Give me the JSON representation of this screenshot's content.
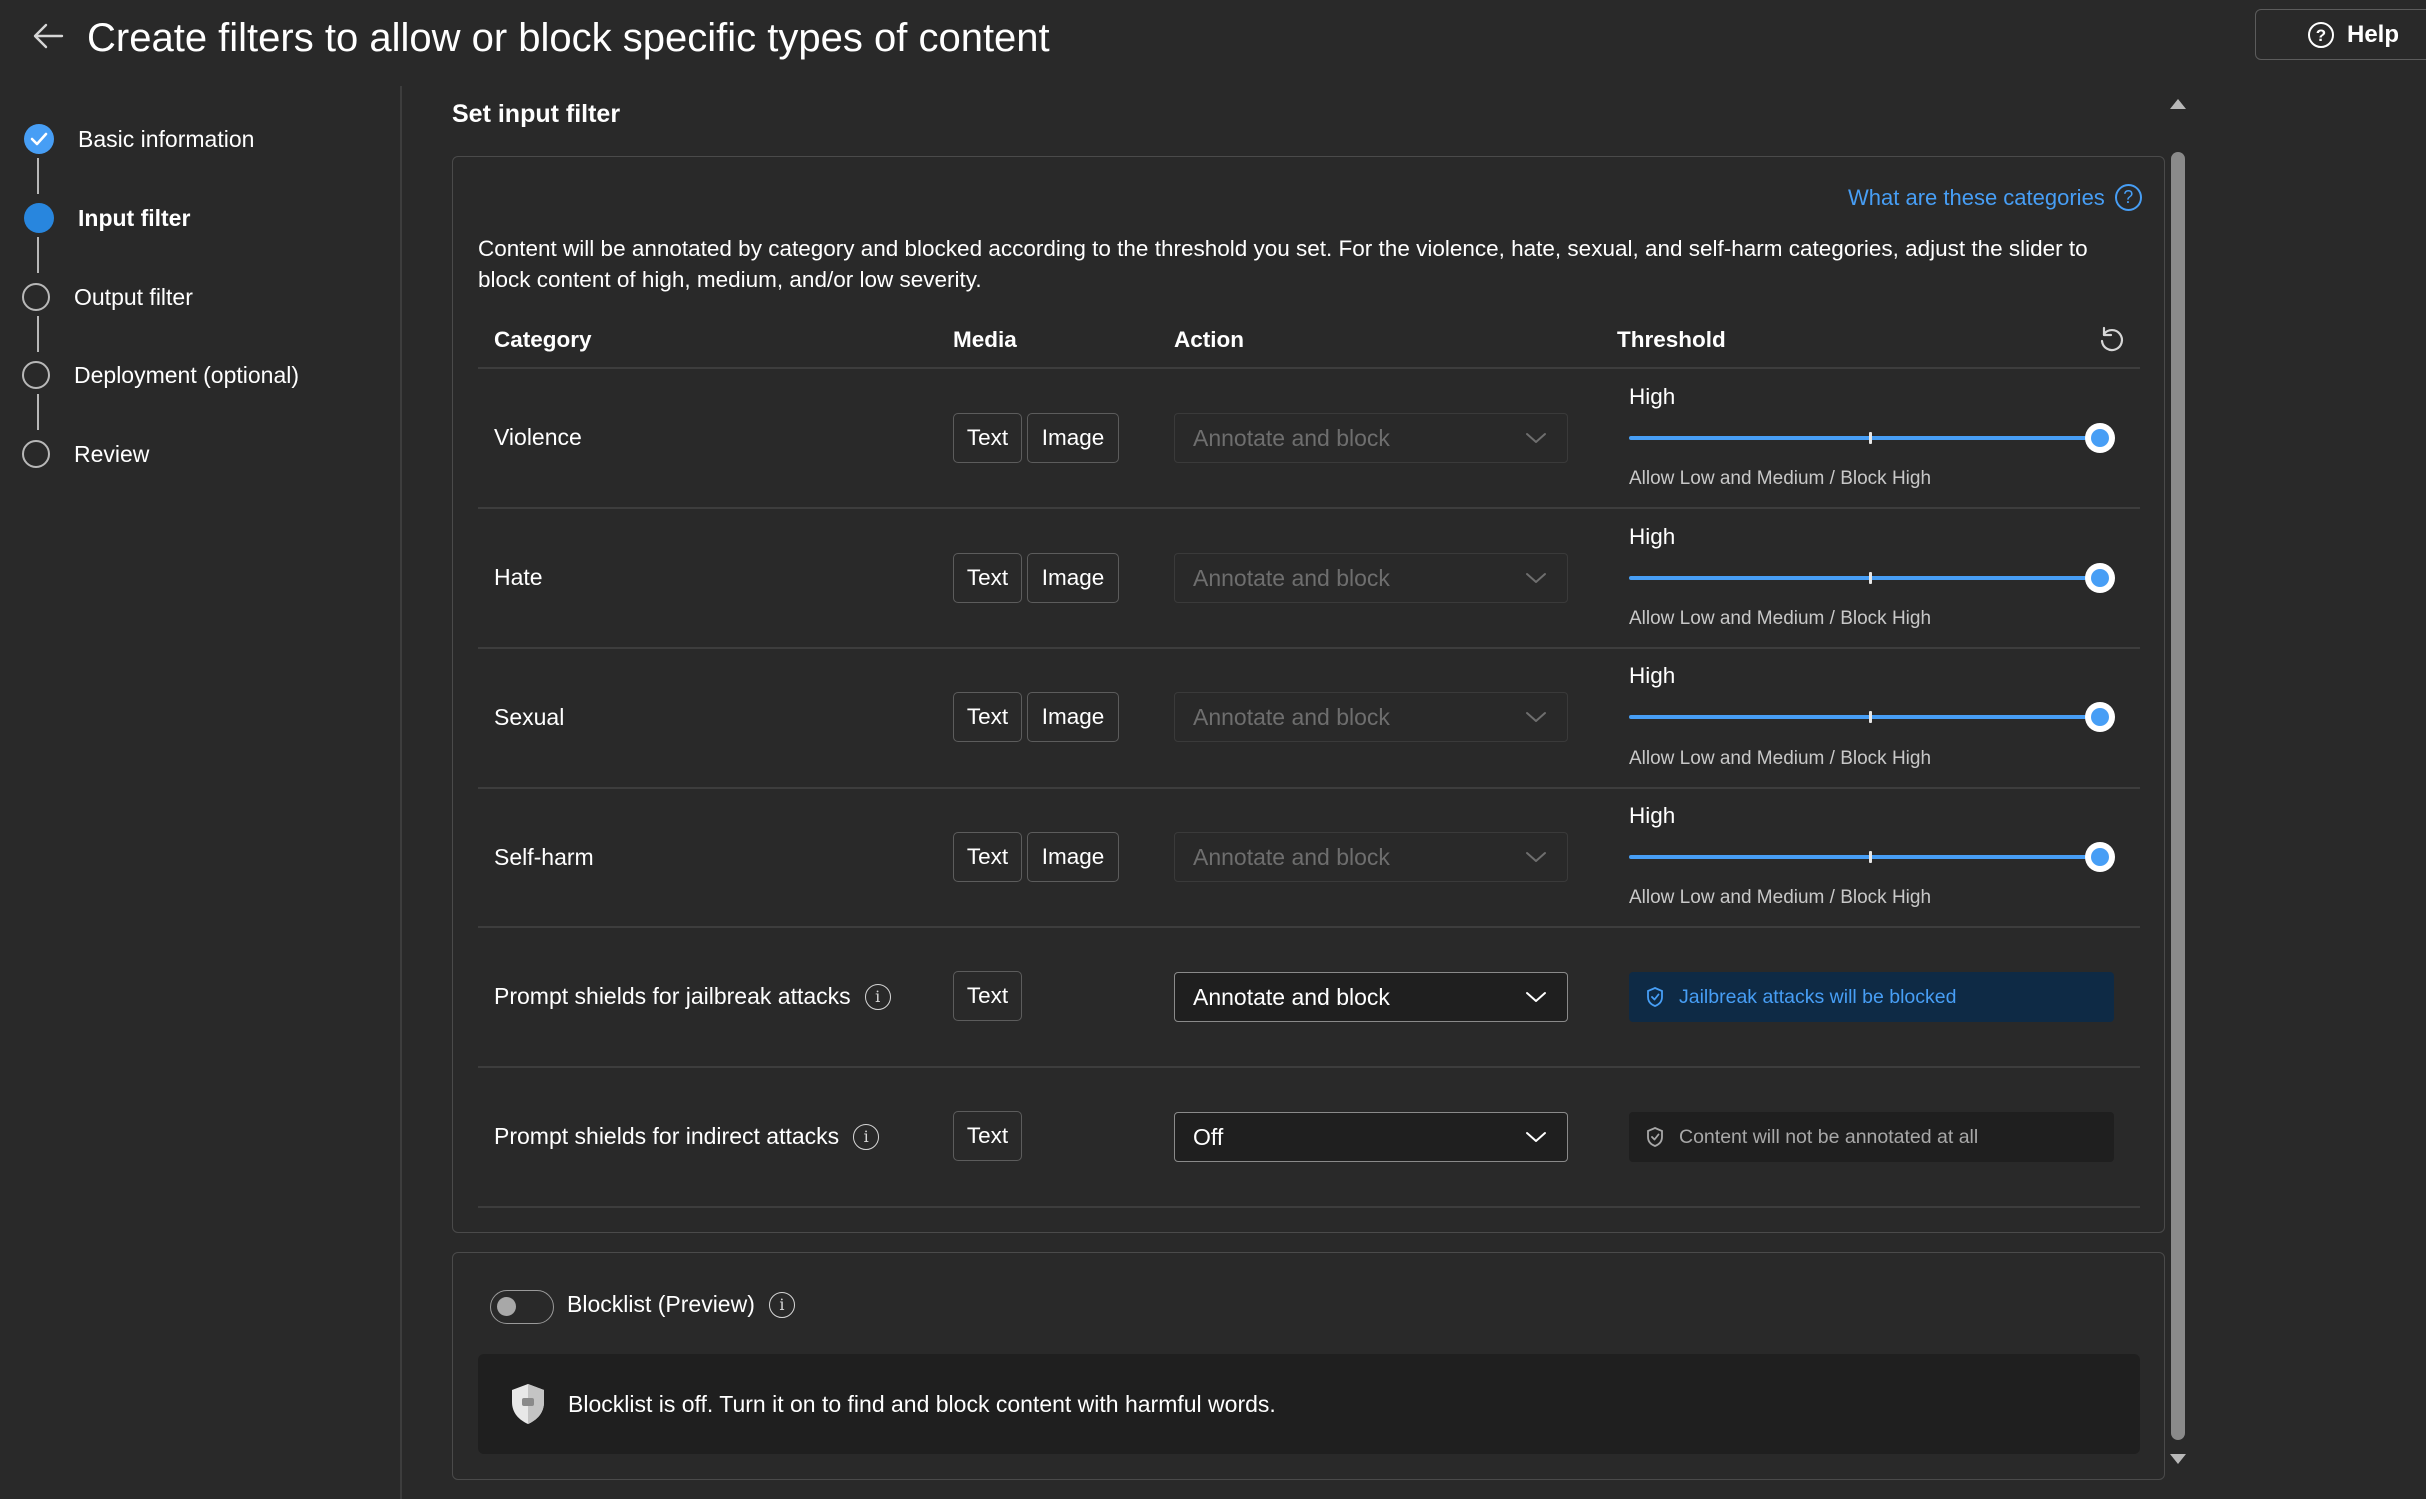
{
  "header": {
    "title": "Create filters to allow or block specific types of content",
    "help_label": "Help"
  },
  "steps": [
    {
      "label": "Basic information",
      "state": "done"
    },
    {
      "label": "Input filter",
      "state": "current"
    },
    {
      "label": "Output filter",
      "state": "pending"
    },
    {
      "label": "Deployment (optional)",
      "state": "pending"
    },
    {
      "label": "Review",
      "state": "pending"
    }
  ],
  "main": {
    "section_title": "Set input filter",
    "categories_link": "What are these categories",
    "description": "Content will be annotated by category and blocked according to the threshold you set. For the violence, hate, sexual, and self-harm categories, adjust the slider to block content of high, medium, and/or low severity.",
    "columns": [
      "Category",
      "Media",
      "Action",
      "Threshold"
    ],
    "media_labels": {
      "text": "Text",
      "image": "Image"
    },
    "rows": [
      {
        "category": "Violence",
        "action": "Annotate and block",
        "threshold": "High",
        "threshold_level": 1.0,
        "caption": "Allow Low and Medium / Block High"
      },
      {
        "category": "Hate",
        "action": "Annotate and block",
        "threshold": "High",
        "threshold_level": 1.0,
        "caption": "Allow Low and Medium / Block High"
      },
      {
        "category": "Sexual",
        "action": "Annotate and block",
        "threshold": "High",
        "threshold_level": 1.0,
        "caption": "Allow Low and Medium / Block High"
      },
      {
        "category": "Self-harm",
        "action": "Annotate and block",
        "threshold": "High",
        "threshold_level": 1.0,
        "caption": "Allow Low and Medium / Block High"
      }
    ],
    "shields": [
      {
        "category": "Prompt shields for jailbreak attacks",
        "action": "Annotate and block",
        "status": "Jailbreak attacks will be blocked"
      },
      {
        "category": "Prompt shields for indirect attacks",
        "action": "Off",
        "status": "Content will not be annotated at all"
      }
    ],
    "blocklist": {
      "label": "Blocklist (Preview)",
      "enabled": false,
      "notice": "Blocklist is off. Turn it on to find and block content with harmful words."
    }
  },
  "colors": {
    "background": "#292929",
    "accent": "#479ef5",
    "blocked_bg": "#0e2a45"
  }
}
